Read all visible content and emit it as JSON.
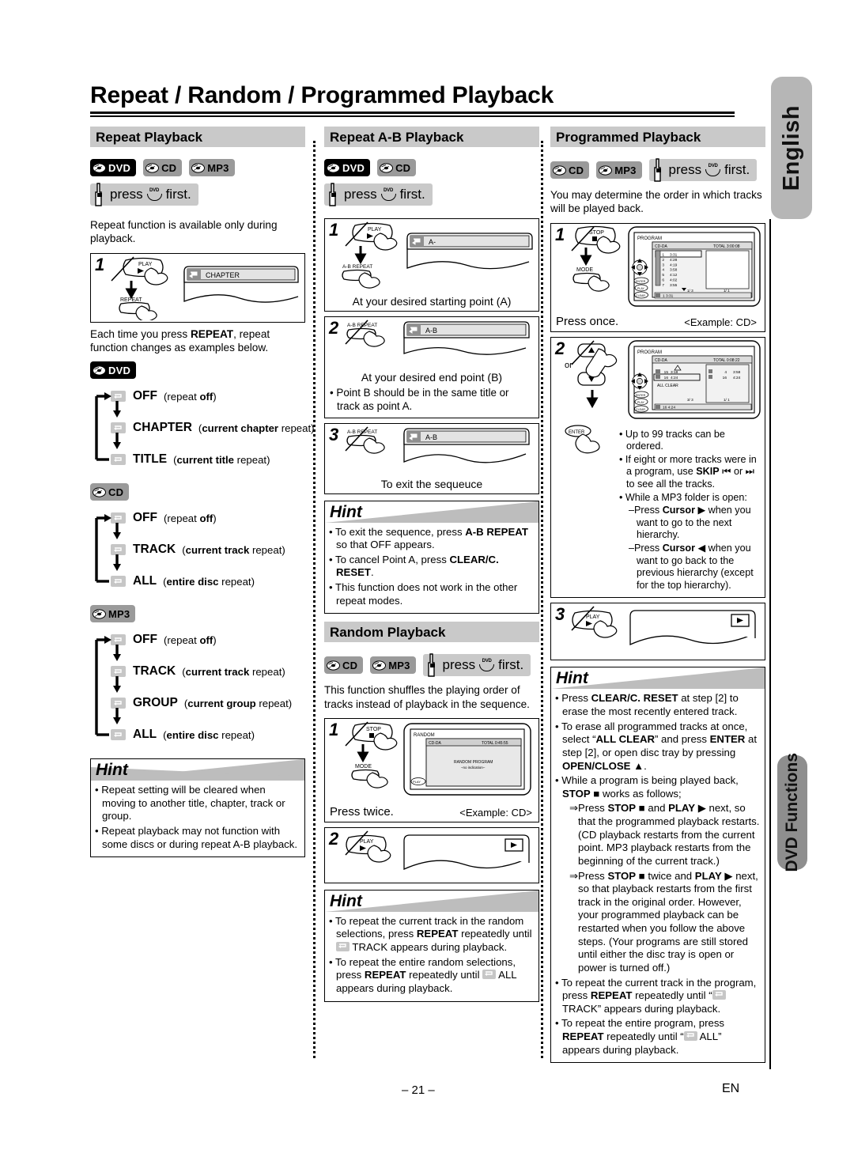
{
  "document": {
    "title": "Repeat / Random / Programmed Playback",
    "page_number": "– 21 –",
    "lang_code": "EN"
  },
  "edge_tabs": {
    "language": "English",
    "section": "DVD Functions"
  },
  "icons": {
    "repeat_indicator": "repeat-icon",
    "disc": "disc-icon",
    "open_close": "open-close-icon"
  },
  "press_first": {
    "pre": "press",
    "post": "first.",
    "tray_label": "DVD"
  },
  "left_column": {
    "heading": "Repeat Playback",
    "badges": [
      "DVD",
      "CD",
      "MP3"
    ],
    "intro": "Repeat function is available only during playback.",
    "step1": {
      "number": "1",
      "buttons": [
        "PLAY",
        "REPEAT"
      ],
      "osd_text": "CHAPTER"
    },
    "after_step": "Each time you press REPEAT, repeat function changes as examples below.",
    "after_step_bold": "REPEAT",
    "flows": [
      {
        "badge": "DVD",
        "items": [
          {
            "label": "OFF",
            "note_pre": "(repeat ",
            "note_bold": "off",
            "note_post": ")"
          },
          {
            "label": "CHAPTER",
            "note_pre": "(",
            "note_bold": "current chapter",
            "note_post": " repeat)"
          },
          {
            "label": "TITLE",
            "note_pre": "(",
            "note_bold": "current title",
            "note_post": " repeat)"
          }
        ]
      },
      {
        "badge": "CD",
        "items": [
          {
            "label": "OFF",
            "note_pre": "(repeat ",
            "note_bold": "off",
            "note_post": ")"
          },
          {
            "label": "TRACK",
            "note_pre": "(",
            "note_bold": "current track",
            "note_post": " repeat)"
          },
          {
            "label": "ALL",
            "note_pre": "(",
            "note_bold": "entire disc",
            "note_post": " repeat)"
          }
        ]
      },
      {
        "badge": "MP3",
        "items": [
          {
            "label": "OFF",
            "note_pre": "(repeat ",
            "note_bold": "off",
            "note_post": ")"
          },
          {
            "label": "TRACK",
            "note_pre": "(",
            "note_bold": "current track",
            "note_post": " repeat)"
          },
          {
            "label": "GROUP",
            "note_pre": "(",
            "note_bold": "current group",
            "note_post": " repeat)"
          },
          {
            "label": "ALL",
            "note_pre": "(",
            "note_bold": "entire disc",
            "note_post": " repeat)"
          }
        ]
      }
    ],
    "hint": {
      "title": "Hint",
      "items": [
        "Repeat setting will be cleared when moving to another title, chapter, track or group.",
        "Repeat playback may not function with some discs or during repeat A-B playback."
      ]
    }
  },
  "middle_column": {
    "heading": "Repeat A-B Playback",
    "badges": [
      "DVD",
      "CD"
    ],
    "steps": [
      {
        "number": "1",
        "buttons": [
          "PLAY",
          "A-B REPEAT"
        ],
        "osd_text": "A-",
        "caption": "At your desired starting point (A)",
        "note": ""
      },
      {
        "number": "2",
        "buttons": [
          "A-B REPEAT"
        ],
        "osd_text": "A-B",
        "caption": "At your desired end point (B)",
        "note": "Point B should be in the same title or track as point A."
      },
      {
        "number": "3",
        "buttons": [
          "A-B REPEAT"
        ],
        "osd_text": "A-B",
        "caption": "To exit the sequeuce",
        "note": ""
      }
    ],
    "hint": {
      "title": "Hint",
      "items": [
        "To exit the sequence, press A-B REPEAT so that OFF appears.",
        "To cancel Point A, press CLEAR/C. RESET.",
        "This function does not work in the other repeat modes."
      ]
    },
    "random": {
      "heading": "Random Playback",
      "badges": [
        "CD",
        "MP3"
      ],
      "intro": "This function shuffles the playing order of tracks instead of playback in the sequence.",
      "step1": {
        "number": "1",
        "buttons": [
          "STOP",
          "MODE"
        ],
        "caption": "Press twice.",
        "example": "<Example: CD>",
        "osd": {
          "title": "RANDOM",
          "disc_type": "CD-DA",
          "total_label": "TOTAL 0:45:55",
          "line1": "RANDOM PROGRAM",
          "line2": "–no indication–",
          "btn": "PLAY"
        }
      },
      "step2": {
        "number": "2",
        "buttons": [
          "PLAY"
        ],
        "osd_badge": "play-icon"
      },
      "hint": {
        "title": "Hint",
        "items": [
          "To repeat the current track in the random selections, press REPEAT repeatedly until ⎔ TRACK appears during playback.",
          "To repeat the entire random selections, press REPEAT repeatedly until ⎔ ALL appears during playback."
        ]
      }
    }
  },
  "right_column": {
    "heading": "Programmed Playback",
    "badges": [
      "CD",
      "MP3"
    ],
    "intro": "You may determine the order in which tracks will be played back.",
    "step1": {
      "number": "1",
      "buttons": [
        "STOP",
        "MODE",
        "ENTER",
        "PLAY",
        "CLEAR"
      ],
      "caption": "Press once.",
      "example": "<Example: CD>",
      "osd": {
        "title": "PROGRAM",
        "disc_type": "CD-DA",
        "total_label": "TOTAL  3:00:08",
        "tracks": [
          {
            "no": "1",
            "time": "3:31"
          },
          {
            "no": "2",
            "time": "4:28"
          },
          {
            "no": "3",
            "time": "4:19"
          },
          {
            "no": "4",
            "time": "3:58"
          },
          {
            "no": "5",
            "time": "4:12"
          },
          {
            "no": "6",
            "time": "4:02"
          },
          {
            "no": "7",
            "time": "3:55"
          }
        ],
        "page_left": "1/ 3",
        "page_right": "1/ 1",
        "status_bar": "1  3:31"
      }
    },
    "step2": {
      "number": "2",
      "or_label": "or",
      "osd": {
        "title": "PROGRAM",
        "disc_type": "CD-DA",
        "total_label": "TOTAL  0:08:22",
        "tracks": [
          {
            "no": "15",
            "time": "3:18"
          },
          {
            "no": "16",
            "time": "4:24"
          }
        ],
        "all_clear": "ALL CLEAR",
        "program": [
          {
            "no": "4",
            "time": "3:58"
          },
          {
            "no": "16",
            "time": "4:24"
          }
        ],
        "page_left": "3/ 3",
        "page_right": "1/ 1",
        "status_bar": "16  4:24"
      },
      "notes": [
        "Up to 99 tracks can be ordered.",
        "If eight or more tracks were in a program, use SKIP ⏮ or ⏭ to see all the tracks.",
        "While a MP3 folder is open:"
      ],
      "subnotes": [
        "–Press Cursor ▶ when you want to go to the next hierarchy.",
        "–Press Cursor ◀ when you want to go back to the previous hierarchy (except for the top hierarchy)."
      ]
    },
    "step3": {
      "number": "3",
      "buttons": [
        "PLAY"
      ],
      "osd_badge": "play-icon"
    },
    "hint": {
      "title": "Hint",
      "items": [
        "Press CLEAR/C. RESET at step [2] to erase the most recently entered track.",
        "To erase all programmed tracks at once, select “ALL CLEAR” and press ENTER at step [2], or open disc tray by pressing OPEN/CLOSE ▲.",
        "While a program is being played back, STOP ■ works as follows;",
        "⇒Press STOP ■ and PLAY ▶ next, so that the programmed playback restarts. (CD playback restarts from the current point. MP3 playback restarts from the beginning of the current track.)",
        "⇒Press STOP ■ twice and PLAY ▶ next, so that playback restarts from the first track in the original order. However, your programmed playback can be restarted when you follow the above steps. (Your programs are still stored until either the disc tray is open or power is turned off.)",
        "To repeat the current track in the program, press REPEAT repeatedly until “⎔ TRACK” appears during playback.",
        "To repeat the entire program, press REPEAT repeatedly until “⎔ ALL” appears during playback."
      ]
    }
  }
}
